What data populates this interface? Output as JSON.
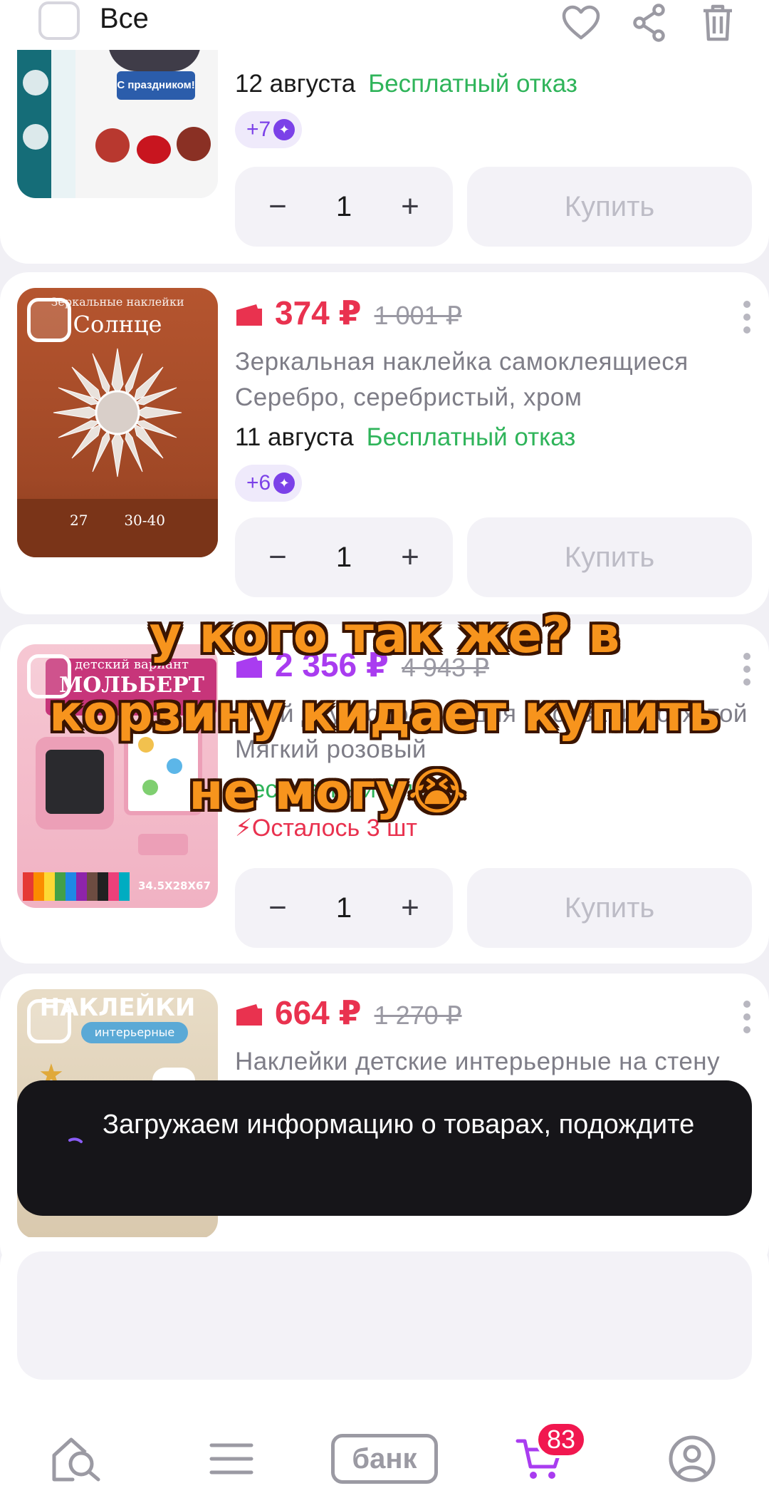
{
  "header": {
    "select_all_label": "Все",
    "icons": [
      "heart-icon",
      "share-icon",
      "trash-icon"
    ]
  },
  "products": [
    {
      "delivery_date": "12 августа",
      "free_cancel": "Бесплатный отказ",
      "badge": "+7",
      "quantity": "1",
      "buy_label": "Купить",
      "image_caption": "С праздником!"
    },
    {
      "price": "374 ₽",
      "old_price": "1 001 ₽",
      "title": "Зеркальная наклейка самоклеящиеся",
      "subtitle": "Серебро, серебристый, хром",
      "delivery_date": "11 августа",
      "free_cancel": "Бесплатный отказ",
      "badge": "+6",
      "quantity": "1",
      "buy_label": "Купить",
      "image_caption": "Солнце",
      "image_caption_top": "Зеркальные наклейки",
      "image_numbers": "27        30-40"
    },
    {
      "price": "2 356 ₽",
      "old_price": "4 943 ₽",
      "title": "Мольберт детский двусторонний для рисования сухстой",
      "subtitle": "Мягкий розовый",
      "free_cancel": "Бесплатный отказ",
      "stock": "Осталось 3 шт",
      "quantity": "1",
      "buy_label": "Купить",
      "image_caption": "МОЛЬБЕРТ",
      "image_caption_top": "детский вариант",
      "image_size": "34.5X28X67"
    },
    {
      "price": "664 ₽",
      "old_price": "1 270 ₽",
      "title": "Наклейки детские интерьерные на стену",
      "image_caption": "НАКЛЕЙКИ",
      "image_caption_sub": "интерьерные"
    }
  ],
  "toast": {
    "text": "Загружаем информацию о товарах, подождите"
  },
  "overlay_caption": {
    "line1": "у кого так же? в",
    "line2": "корзину кидает купить",
    "line3": "не могу😭"
  },
  "nav": {
    "items": [
      "home-search-icon",
      "catalog-icon",
      "bank",
      "cart-icon",
      "profile-icon"
    ],
    "bank_label": "банк",
    "cart_count": "83"
  },
  "colors": {
    "price_red": "#e9324f",
    "price_purple": "#a93cf0",
    "accent_purple": "#7b41e8",
    "free_green": "#2fb45a",
    "overlay_orange": "#f7941d"
  }
}
